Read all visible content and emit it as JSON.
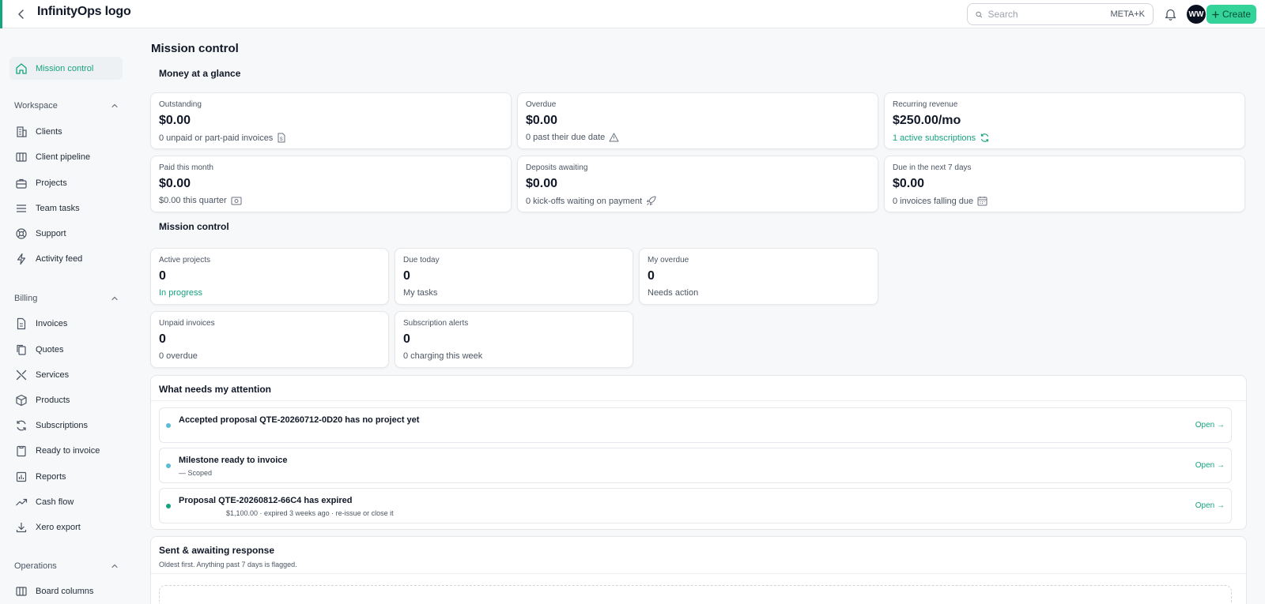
{
  "app": {
    "logo_text": "InfinityOps logo",
    "accent_color": "#16a37f",
    "create_button_color": "#34d399"
  },
  "header": {
    "search_placeholder": "Search",
    "search_shortcut": "META+K",
    "avatar_initials": "WW",
    "create_label": "Create",
    "icons": [
      "chevron-left-icon",
      "search-icon",
      "bell-icon",
      "plus-icon"
    ]
  },
  "sidebar": {
    "top_item": {
      "label": "Mission control",
      "icon": "home-icon",
      "active": true
    },
    "sections": [
      {
        "title": "Workspace",
        "items": [
          {
            "label": "Clients",
            "icon": "building-icon"
          },
          {
            "label": "Client pipeline",
            "icon": "columns-icon"
          },
          {
            "label": "Projects",
            "icon": "briefcase-icon"
          },
          {
            "label": "Team tasks",
            "icon": "list-icon"
          },
          {
            "label": "Support",
            "icon": "lifebuoy-icon"
          },
          {
            "label": "Activity feed",
            "icon": "bolt-icon"
          }
        ]
      },
      {
        "title": "Billing",
        "items": [
          {
            "label": "Invoices",
            "icon": "document-icon"
          },
          {
            "label": "Quotes",
            "icon": "copy-icon"
          },
          {
            "label": "Services",
            "icon": "tools-icon"
          },
          {
            "label": "Products",
            "icon": "box-icon"
          },
          {
            "label": "Subscriptions",
            "icon": "refresh-icon"
          },
          {
            "label": "Ready to invoice",
            "icon": "clipboard-icon"
          },
          {
            "label": "Reports",
            "icon": "report-icon"
          },
          {
            "label": "Cash flow",
            "icon": "trend-icon"
          },
          {
            "label": "Xero export",
            "icon": "download-icon"
          }
        ]
      },
      {
        "title": "Operations",
        "items": [
          {
            "label": "Board columns",
            "icon": "board-icon"
          }
        ]
      }
    ]
  },
  "main": {
    "page_title": "Mission control",
    "money": {
      "title": "Money at a glance",
      "cards": [
        {
          "label": "Outstanding",
          "value": "$0.00",
          "sub": "0 unpaid or part-paid invoices",
          "icon": "dollar-file-icon",
          "green": false
        },
        {
          "label": "Overdue",
          "value": "$0.00",
          "sub": "0 past their due date",
          "icon": "warning-icon",
          "green": false
        },
        {
          "label": "Recurring revenue",
          "value": "$250.00/mo",
          "sub": "1 active subscriptions",
          "icon": "refresh-icon",
          "green": true
        },
        {
          "label": "Paid this month",
          "value": "$0.00",
          "sub": "$0.00 this quarter",
          "icon": "cash-icon",
          "green": false
        },
        {
          "label": "Deposits awaiting",
          "value": "$0.00",
          "sub": "0 kick-offs waiting on payment",
          "icon": "rocket-icon",
          "green": false
        },
        {
          "label": "Due in the next 7 days",
          "value": "$0.00",
          "sub": "0 invoices falling due",
          "icon": "calendar-icon",
          "green": false
        }
      ]
    },
    "mission": {
      "title": "Mission control",
      "cards": [
        {
          "label": "Active projects",
          "value": "0",
          "sub": "In progress",
          "green": true
        },
        {
          "label": "Due today",
          "value": "0",
          "sub": "My tasks",
          "green": false
        },
        {
          "label": "My overdue",
          "value": "0",
          "sub": "Needs action",
          "green": false
        },
        {
          "label": "Unpaid invoices",
          "value": "0",
          "sub": "0 overdue",
          "green": false
        },
        {
          "label": "Subscription alerts",
          "value": "0",
          "sub": "0 charging this week",
          "green": false
        }
      ]
    },
    "attention": {
      "title": "What needs my attention",
      "items": [
        {
          "title": "Accepted proposal QTE-20260712-0D20 has no project yet",
          "sub": "",
          "open": "Open →",
          "dot_color": "#5bbcd6"
        },
        {
          "title": "Milestone ready to invoice",
          "sub": "— Scoped",
          "open": "Open →",
          "dot_color": "#5bbcd6"
        },
        {
          "title": "Proposal QTE-20260812-66C4 has expired",
          "sub": "$1,100.00 · expired 3 weeks ago · re-issue or close it",
          "open": "Open →",
          "dot_color": "#16a37f"
        }
      ]
    },
    "sent": {
      "title": "Sent & awaiting response",
      "subtitle": "Oldest first. Anything past 7 days is flagged."
    }
  }
}
